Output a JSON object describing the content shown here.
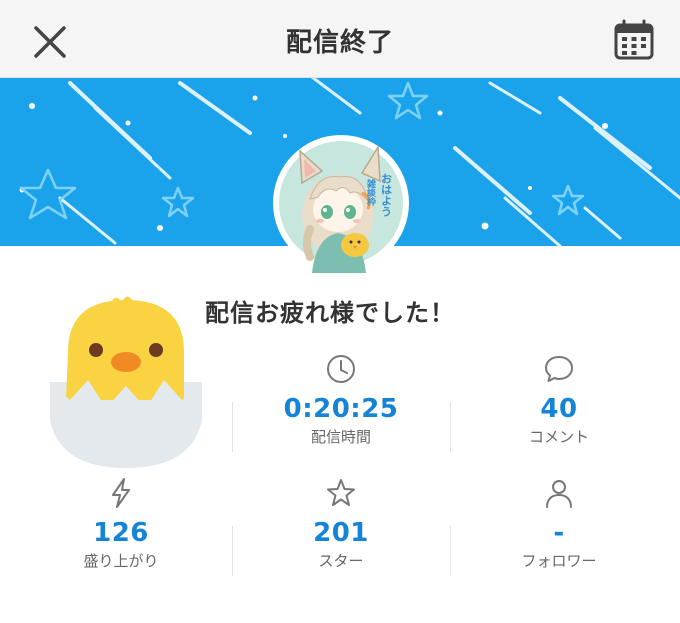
{
  "header": {
    "title": "配信終了",
    "close_icon": "close-icon",
    "calendar_icon": "calendar-icon"
  },
  "colors": {
    "banner": "#1aa3ea",
    "accent": "#1583d6",
    "chick": "#f9d342"
  },
  "greeting": "配信お疲れ様でした！",
  "avatar_text": "おはよう 雑談枠",
  "stats": [
    {
      "icon": "clock-icon",
      "value": "0:20:25",
      "label": "配信時間"
    },
    {
      "icon": "comment-icon",
      "value": "40",
      "label": "コメント"
    },
    {
      "icon": "lightning-icon",
      "value": "126",
      "label": "盛り上がり"
    },
    {
      "icon": "star-icon",
      "value": "201",
      "label": "スター"
    },
    {
      "icon": "person-icon",
      "value": "-",
      "label": "フォロワー"
    }
  ]
}
